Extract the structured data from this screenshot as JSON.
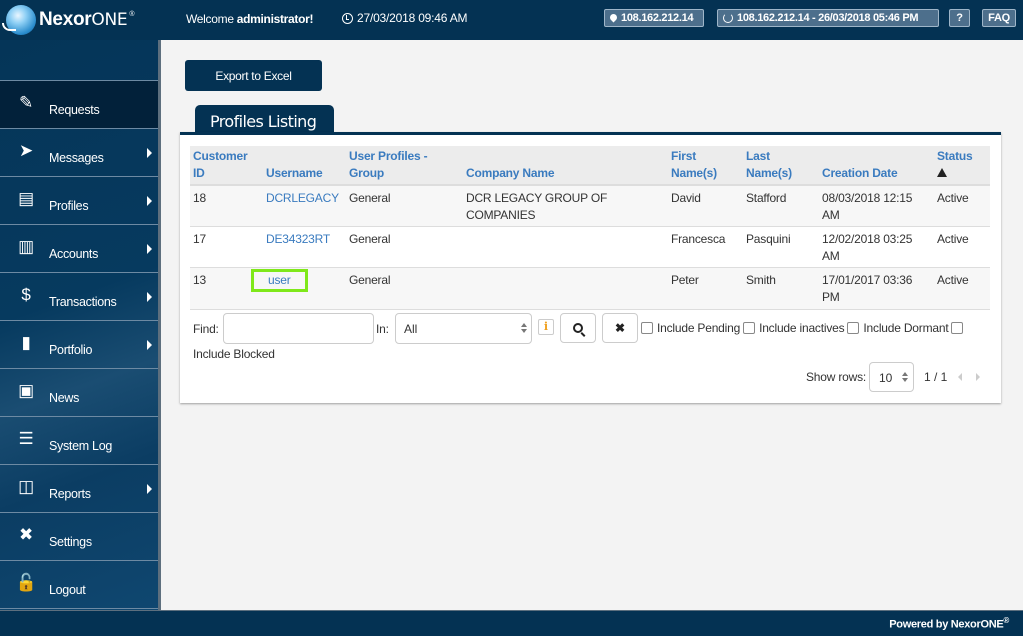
{
  "header": {
    "brand_bold": "Nexor",
    "brand_light": "ONE",
    "brand_mark": "®",
    "welcome_prefix": "Welcome ",
    "welcome_user": "administrator!",
    "datetime": "27/03/2018 09:46 AM",
    "ip_badge": "108.162.212.14",
    "last_login_badge": "108.162.212.14 - 26/03/2018 05:46 PM",
    "help_label": "?",
    "faq_label": "FAQ"
  },
  "sidebar": {
    "items": [
      {
        "label": "Requests",
        "icon": "lamp-icon",
        "glyph": "✎",
        "active": true,
        "submenu": false
      },
      {
        "label": "Messages",
        "icon": "paper-plane-icon",
        "glyph": "➤",
        "active": false,
        "submenu": true
      },
      {
        "label": "Profiles",
        "icon": "address-book-icon",
        "glyph": "▤",
        "active": false,
        "submenu": true
      },
      {
        "label": "Accounts",
        "icon": "binders-icon",
        "glyph": "▥",
        "active": false,
        "submenu": true
      },
      {
        "label": "Transactions",
        "icon": "money-bag-icon",
        "glyph": "$",
        "active": false,
        "submenu": true
      },
      {
        "label": "Portfolio",
        "icon": "briefcase-icon",
        "glyph": "▮",
        "active": false,
        "submenu": true
      },
      {
        "label": "News",
        "icon": "radio-icon",
        "glyph": "▣",
        "active": false,
        "submenu": false
      },
      {
        "label": "System Log",
        "icon": "sliders-icon",
        "glyph": "☰",
        "active": false,
        "submenu": false
      },
      {
        "label": "Reports",
        "icon": "presentation-icon",
        "glyph": "◫",
        "active": false,
        "submenu": true
      },
      {
        "label": "Settings",
        "icon": "tools-icon",
        "glyph": "✖",
        "active": false,
        "submenu": false
      },
      {
        "label": "Logout",
        "icon": "unlock-icon",
        "glyph": "🔓",
        "active": false,
        "submenu": false
      }
    ]
  },
  "main": {
    "export_label": "Export to Excel",
    "tab_title": "Profiles Listing",
    "table": {
      "columns": [
        "Customer ID",
        "Username",
        "User Profiles - Group",
        "Company Name",
        "First Name(s)",
        "Last Name(s)",
        "Creation Date",
        "Status"
      ],
      "sorted_column": "Status",
      "sort_direction": "ascending",
      "rows": [
        {
          "customer_id": "18",
          "username": "DCRLEGACY",
          "group": "General",
          "company": "DCR LEGACY GROUP OF COMPANIES",
          "first_name": "David",
          "last_name": "Stafford",
          "created": "08/03/2018 12:15 AM",
          "status": "Active"
        },
        {
          "customer_id": "17",
          "username": "DE34323RT",
          "group": "General",
          "company": "",
          "first_name": "Francesca",
          "last_name": "Pasquini",
          "created": "12/02/2018 03:25 AM",
          "status": "Active"
        },
        {
          "customer_id": "13",
          "username": "user",
          "group": "General",
          "company": "",
          "first_name": "Peter",
          "last_name": "Smith",
          "created": "17/01/2017 03:36 PM",
          "status": "Active"
        }
      ]
    },
    "filter": {
      "find_label": "Find:",
      "find_value": "",
      "in_label": "In:",
      "in_value": "All",
      "checkboxes": [
        {
          "label": "Include Pending",
          "checked": false
        },
        {
          "label": "Include inactives",
          "checked": false
        },
        {
          "label": "Include Dormant",
          "checked": false
        },
        {
          "label": "Include Blocked",
          "checked": false
        }
      ]
    },
    "pager": {
      "show_rows_label": "Show rows:",
      "rows_value": "10",
      "page_info": "1 / 1"
    }
  },
  "footer": {
    "text": "Powered by NexorONE",
    "mark": "®"
  },
  "colors": {
    "brand_navy": "#043253",
    "link_blue": "#3a7bbf",
    "highlight_green": "#7fe81a",
    "info_orange": "#f0a020"
  }
}
